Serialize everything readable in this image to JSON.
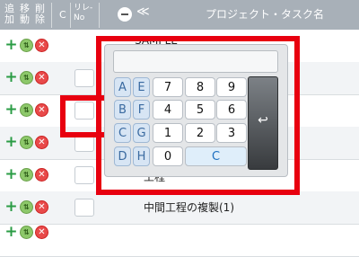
{
  "header": {
    "col_add": "追\n加",
    "col_move": "移\n動",
    "col_del": "削\n除",
    "col_c": "C",
    "col_relay": "リレ-\nNo",
    "collapse_glyph": "≪",
    "col_task": "プロジェクト・タスク名"
  },
  "row_buttons": {
    "add": "+",
    "move": "⇅",
    "delete": "✕"
  },
  "rows": [
    {
      "text": "SAMPLE"
    },
    {
      "text": ""
    },
    {
      "text": ""
    },
    {
      "text": ""
    },
    {
      "text": "工程"
    },
    {
      "text": "中間工程の複製(1)"
    },
    {
      "text": ""
    }
  ],
  "keypad": {
    "display": "",
    "keys": [
      "A",
      "E",
      "7",
      "8",
      "9",
      "B",
      "F",
      "4",
      "5",
      "6",
      "C",
      "G",
      "1",
      "2",
      "3",
      "D",
      "H",
      "0",
      "C"
    ],
    "enter_glyph": "↩"
  }
}
